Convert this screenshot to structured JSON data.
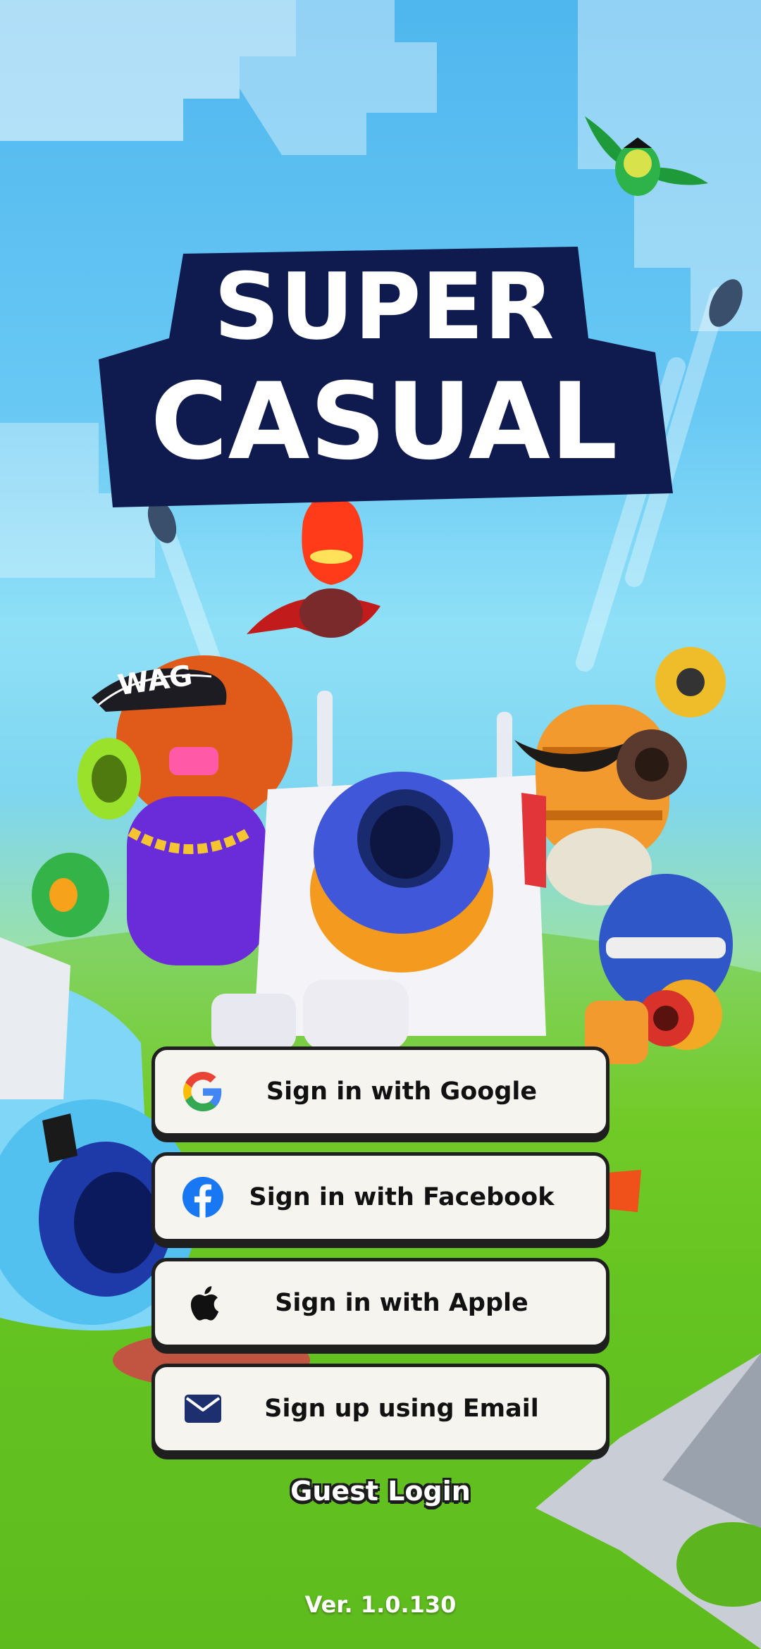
{
  "game": {
    "title_line1": "SUPER",
    "title_line2": "CASUAL",
    "cap_text": "WAG"
  },
  "login": {
    "google_label": "Sign in with Google",
    "facebook_label": "Sign in with Facebook",
    "apple_label": "Sign in with Apple",
    "email_label": "Sign up using Email",
    "guest_label": "Guest Login"
  },
  "footer": {
    "version": "Ver. 1.0.130"
  },
  "colors": {
    "logo_navy": "#0f1a4e",
    "button_bg": "#f6f4ef",
    "button_border": "#1f1f1f",
    "google_blue": "#4285F4",
    "google_red": "#EA4335",
    "google_yellow": "#FBBC05",
    "google_green": "#34A853",
    "facebook_blue": "#1877F2",
    "email_navy": "#1d2f6e"
  },
  "icons": [
    "google-icon",
    "facebook-icon",
    "apple-icon",
    "email-icon"
  ]
}
